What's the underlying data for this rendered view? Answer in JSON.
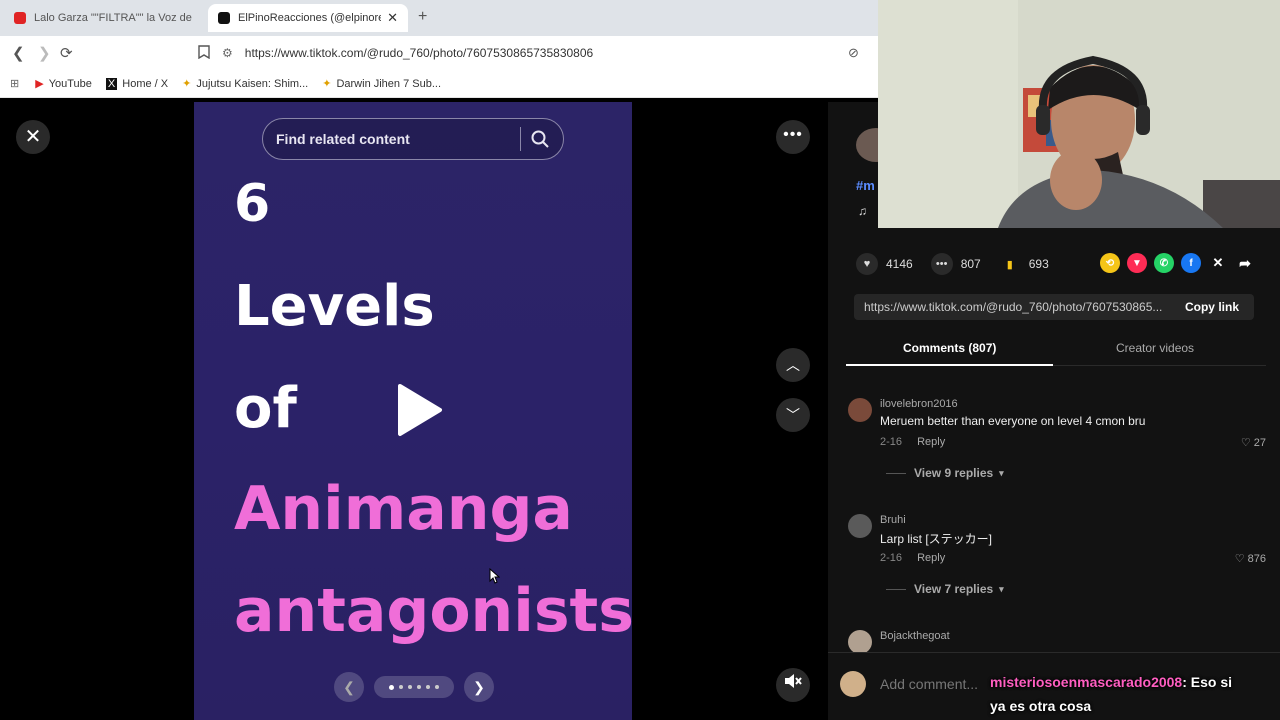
{
  "browser": {
    "tabs": [
      {
        "title": "Lalo Garza \"\"FILTRA\"\" la Voz de Moro",
        "favicon_color": "#e02424",
        "active": false
      },
      {
        "title": "ElPinoReacciones (@elpinoreac",
        "favicon_color": "#111111",
        "active": true
      }
    ],
    "url": "https://www.tiktok.com/@rudo_760/photo/7607530865735830806",
    "bookmarks": [
      {
        "label": "YouTube",
        "icon": "youtube-icon"
      },
      {
        "label": "Home / X",
        "icon": "x-icon"
      },
      {
        "label": "Jujutsu Kaisen: Shim...",
        "icon": "star-icon"
      },
      {
        "label": "Darwin Jihen 7 Sub...",
        "icon": "star-icon"
      }
    ]
  },
  "viewer": {
    "search_placeholder": "Find related content",
    "slide_lines": [
      "6",
      "Levels",
      "of",
      "Animanga",
      "antagonists"
    ],
    "accent_color": "#f06ed8"
  },
  "panel": {
    "hashtag_partial": "#m",
    "likes": "4146",
    "comments": "807",
    "bookmarks": "693",
    "share_link": "https://www.tiktok.com/@rudo_760/photo/7607530865...",
    "copy_label": "Copy link",
    "tabs": {
      "comments": "Comments (807)",
      "creator": "Creator videos"
    },
    "comment_list": [
      {
        "user": "ilovelebron2016",
        "text": "Meruem better than everyone on level 4 cmon bru",
        "date": "2-16",
        "reply": "Reply",
        "likes": "27",
        "view_replies": "View 9 replies"
      },
      {
        "user": "Bruhi",
        "text": "Larp list [ステッカー]",
        "date": "2-16",
        "reply": "Reply",
        "likes": "876",
        "view_replies": "View 7 replies"
      }
    ],
    "comment3_user": "Bojackthegoat",
    "add_comment_placeholder": "Add comment..."
  },
  "overlay_chat": {
    "user": "misteriosoenmascarado2008",
    "separator": ":",
    "message_inline": "Eso si",
    "message_line2": "ya es otra cosa"
  }
}
